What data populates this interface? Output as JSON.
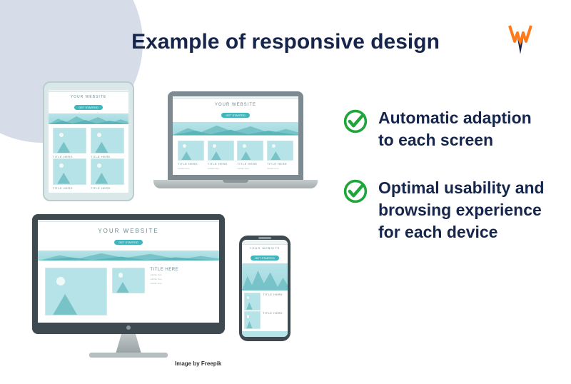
{
  "title": "Example of responsive design",
  "logo": {
    "name": "brand-w-icon",
    "color_top": "#ff7a1a",
    "color_bottom": "#16254c"
  },
  "benefits": [
    {
      "text": "Automatic adaption to each screen"
    },
    {
      "text": "Optimal usability and browsing experience for each device"
    }
  ],
  "site": {
    "title": "YOUR WEBSITE",
    "button": "GET STARTED",
    "card_title": "TITLE HERE",
    "card_subtitle": "subtitle here"
  },
  "attribution": "Image by Freepik",
  "colors": {
    "heading": "#16254c",
    "bg_blob": "#d6dde9",
    "check": "#1ea63b",
    "teal_light": "#b6e3e8",
    "teal": "#3fb6bd"
  }
}
